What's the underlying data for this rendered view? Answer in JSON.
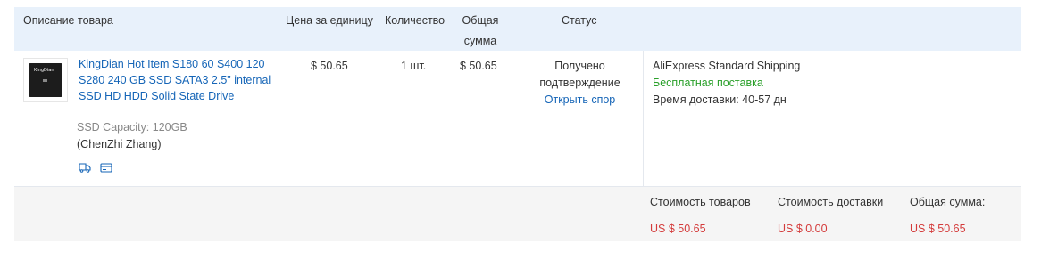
{
  "headers": {
    "description": "Описание товара",
    "unit_price": "Цена за единицу",
    "quantity": "Количество",
    "total": "Общая сумма",
    "status": "Статус"
  },
  "product": {
    "thumb_brand": "KingDian",
    "title": "KingDian Hot Item S180 60 S400 120 S280 240 GB SSD SATA3 2.5\" internal SSD HD HDD Solid State Drive",
    "property": "SSD Capacity: 120GB",
    "seller": "(ChenZhi Zhang)",
    "icons": [
      "delivery-truck-icon",
      "card-icon"
    ],
    "unit_price": "$ 50.65",
    "quantity": "1 шт.",
    "total": "$ 50.65"
  },
  "status": {
    "line1": "Получено",
    "line2": "подтверждение",
    "dispute_link": "Открыть спор"
  },
  "shipping": {
    "method": "AliExpress Standard Shipping",
    "free": "Бесплатная поставка",
    "time_label": "Время доставки:",
    "time_value": "40-57 дн"
  },
  "summary": {
    "goods_label": "Стоимость товаров",
    "goods_value": "US $ 50.65",
    "shipping_label": "Стоимость доставки",
    "shipping_value": "US $ 0.00",
    "total_label": "Общая сумма:",
    "total_value": "US $ 50.65"
  },
  "colors": {
    "link": "#1565b7",
    "free_shipping": "#2aa02a",
    "price_red": "#d43b3b",
    "header_bg": "#e8f1fb",
    "footer_bg": "#f5f5f5"
  }
}
